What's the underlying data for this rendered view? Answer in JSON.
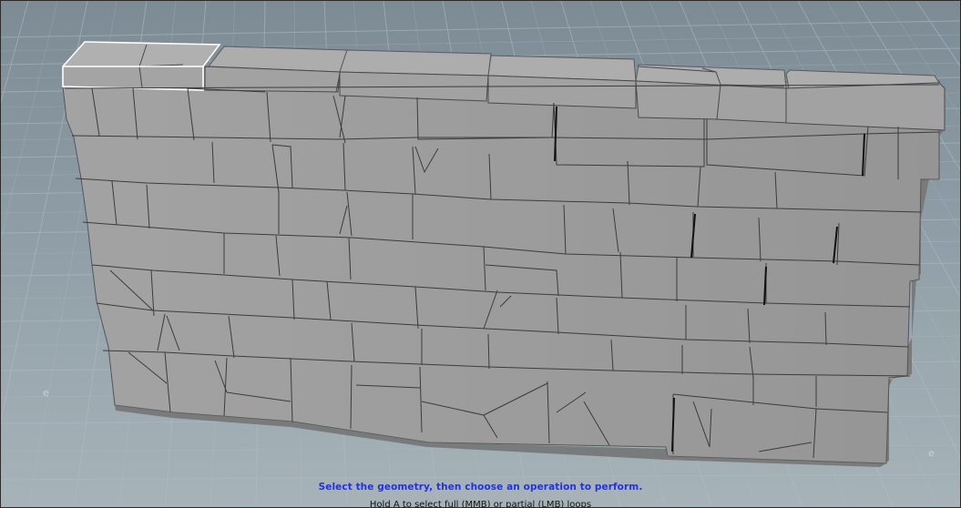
{
  "viewport": {
    "background_color": "#8c9aa3",
    "grid_color": "#a9b5bc",
    "wall_face_color": "#9c9c9c",
    "wall_top_color": "#a8a8a8",
    "wall_side_color": "#7d7d7d",
    "seam_color": "#3d3d3d",
    "selection_color": "#ffffff"
  },
  "status": {
    "instruction": "Select the geometry, then choose an operation to perform.",
    "sub_instruction": "Hold A to select full (MMB) or partial (LMB) loops",
    "instruction_color": "#2233dd"
  },
  "scene": {
    "object_name": "stone-wall",
    "selected_block": "top-left-capstone"
  }
}
